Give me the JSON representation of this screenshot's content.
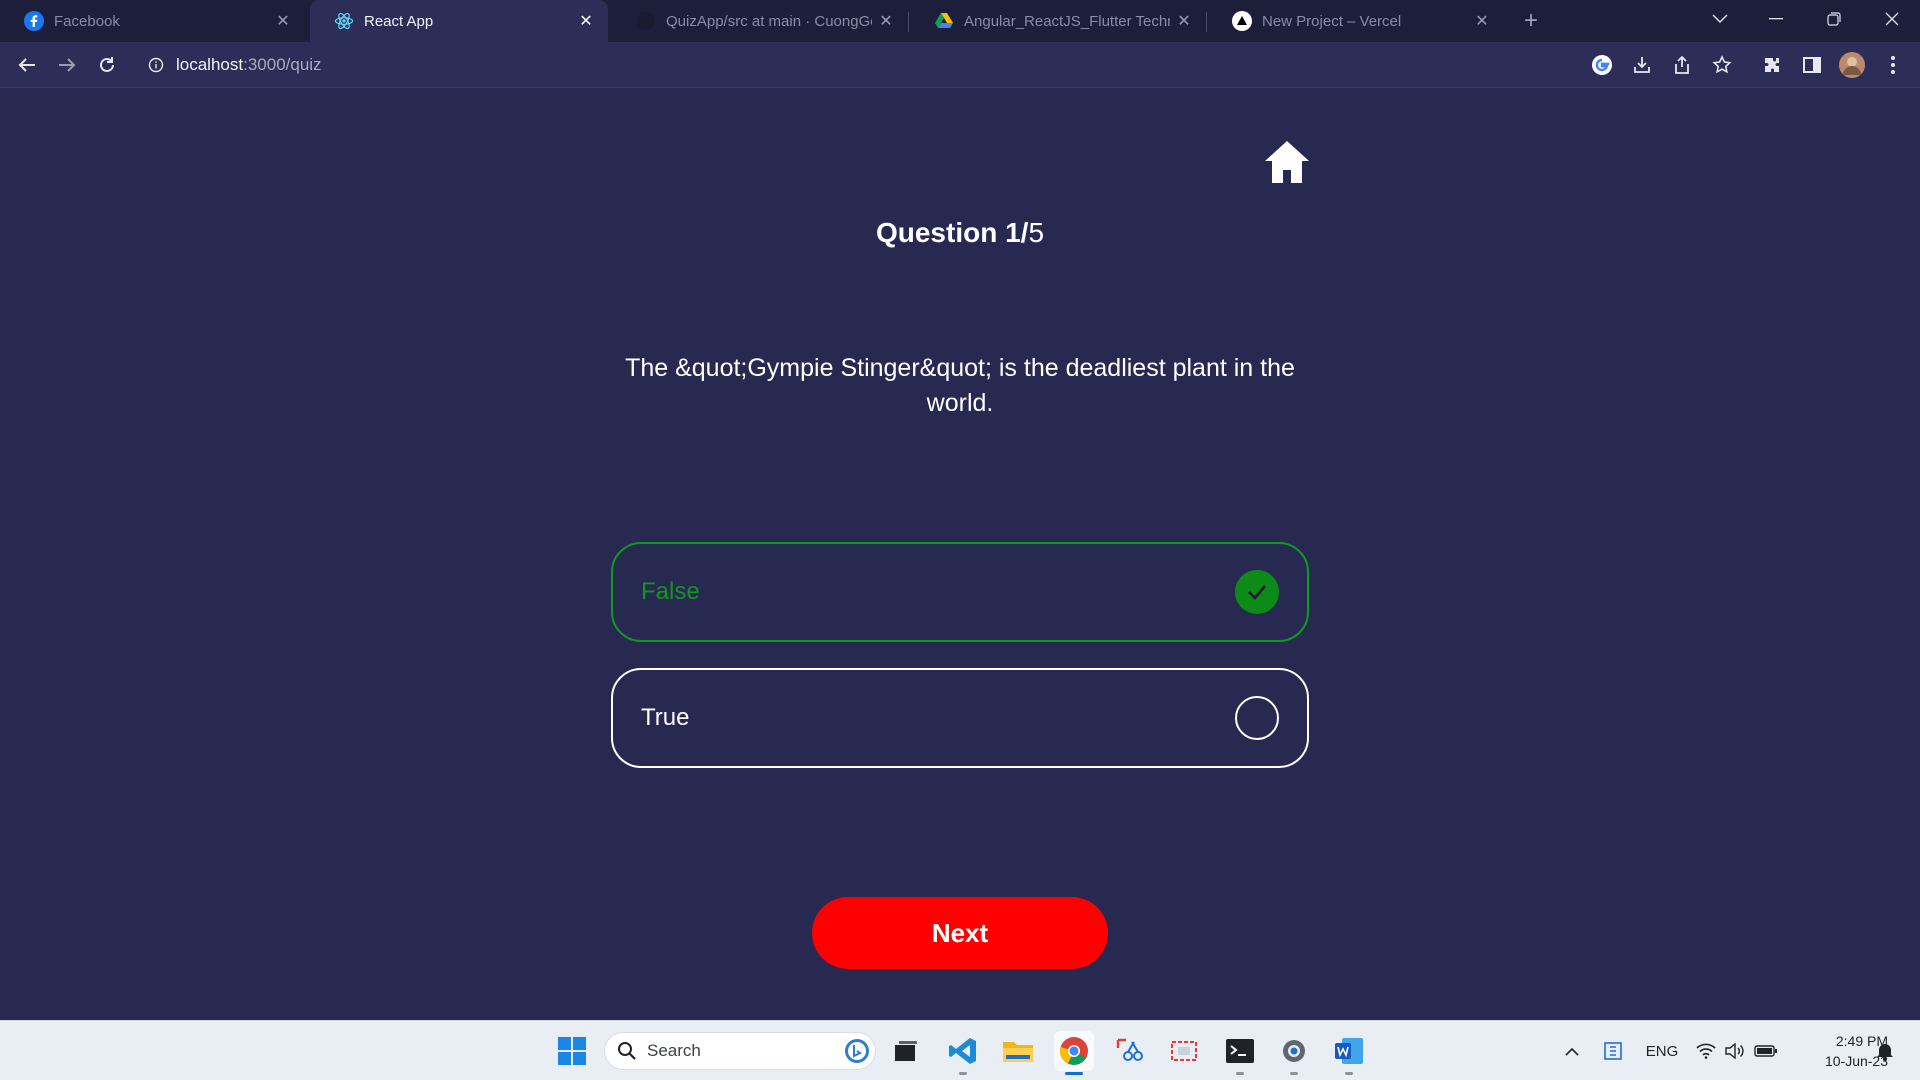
{
  "browser": {
    "tabs": [
      {
        "title": "Facebook",
        "icon": "facebook-icon"
      },
      {
        "title": "React App",
        "icon": "react-icon"
      },
      {
        "title": "QuizApp/src at main · CuongGos",
        "icon": "github-icon"
      },
      {
        "title": "Angular_ReactJS_Flutter Technica",
        "icon": "google-drive-icon"
      },
      {
        "title": "New Project – Vercel",
        "icon": "vercel-icon"
      }
    ],
    "active_tab": 1,
    "address": {
      "host": "localhost",
      "path": ":3000/quiz"
    }
  },
  "quiz": {
    "current": "Question 1/",
    "total": "5",
    "question": "The &quot;Gympie Stinger&quot; is the deadliest plant in the world.",
    "answers": [
      {
        "label": "False",
        "state": "correct"
      },
      {
        "label": "True",
        "state": "unselected"
      }
    ],
    "next_label": "Next",
    "colors": {
      "background": "#272950",
      "correct": "#0f9a1f",
      "next": "#ff0000"
    }
  },
  "taskbar": {
    "search_label": "Search",
    "language": "ENG",
    "time": "2:49 PM",
    "date": "10-Jun-23"
  }
}
